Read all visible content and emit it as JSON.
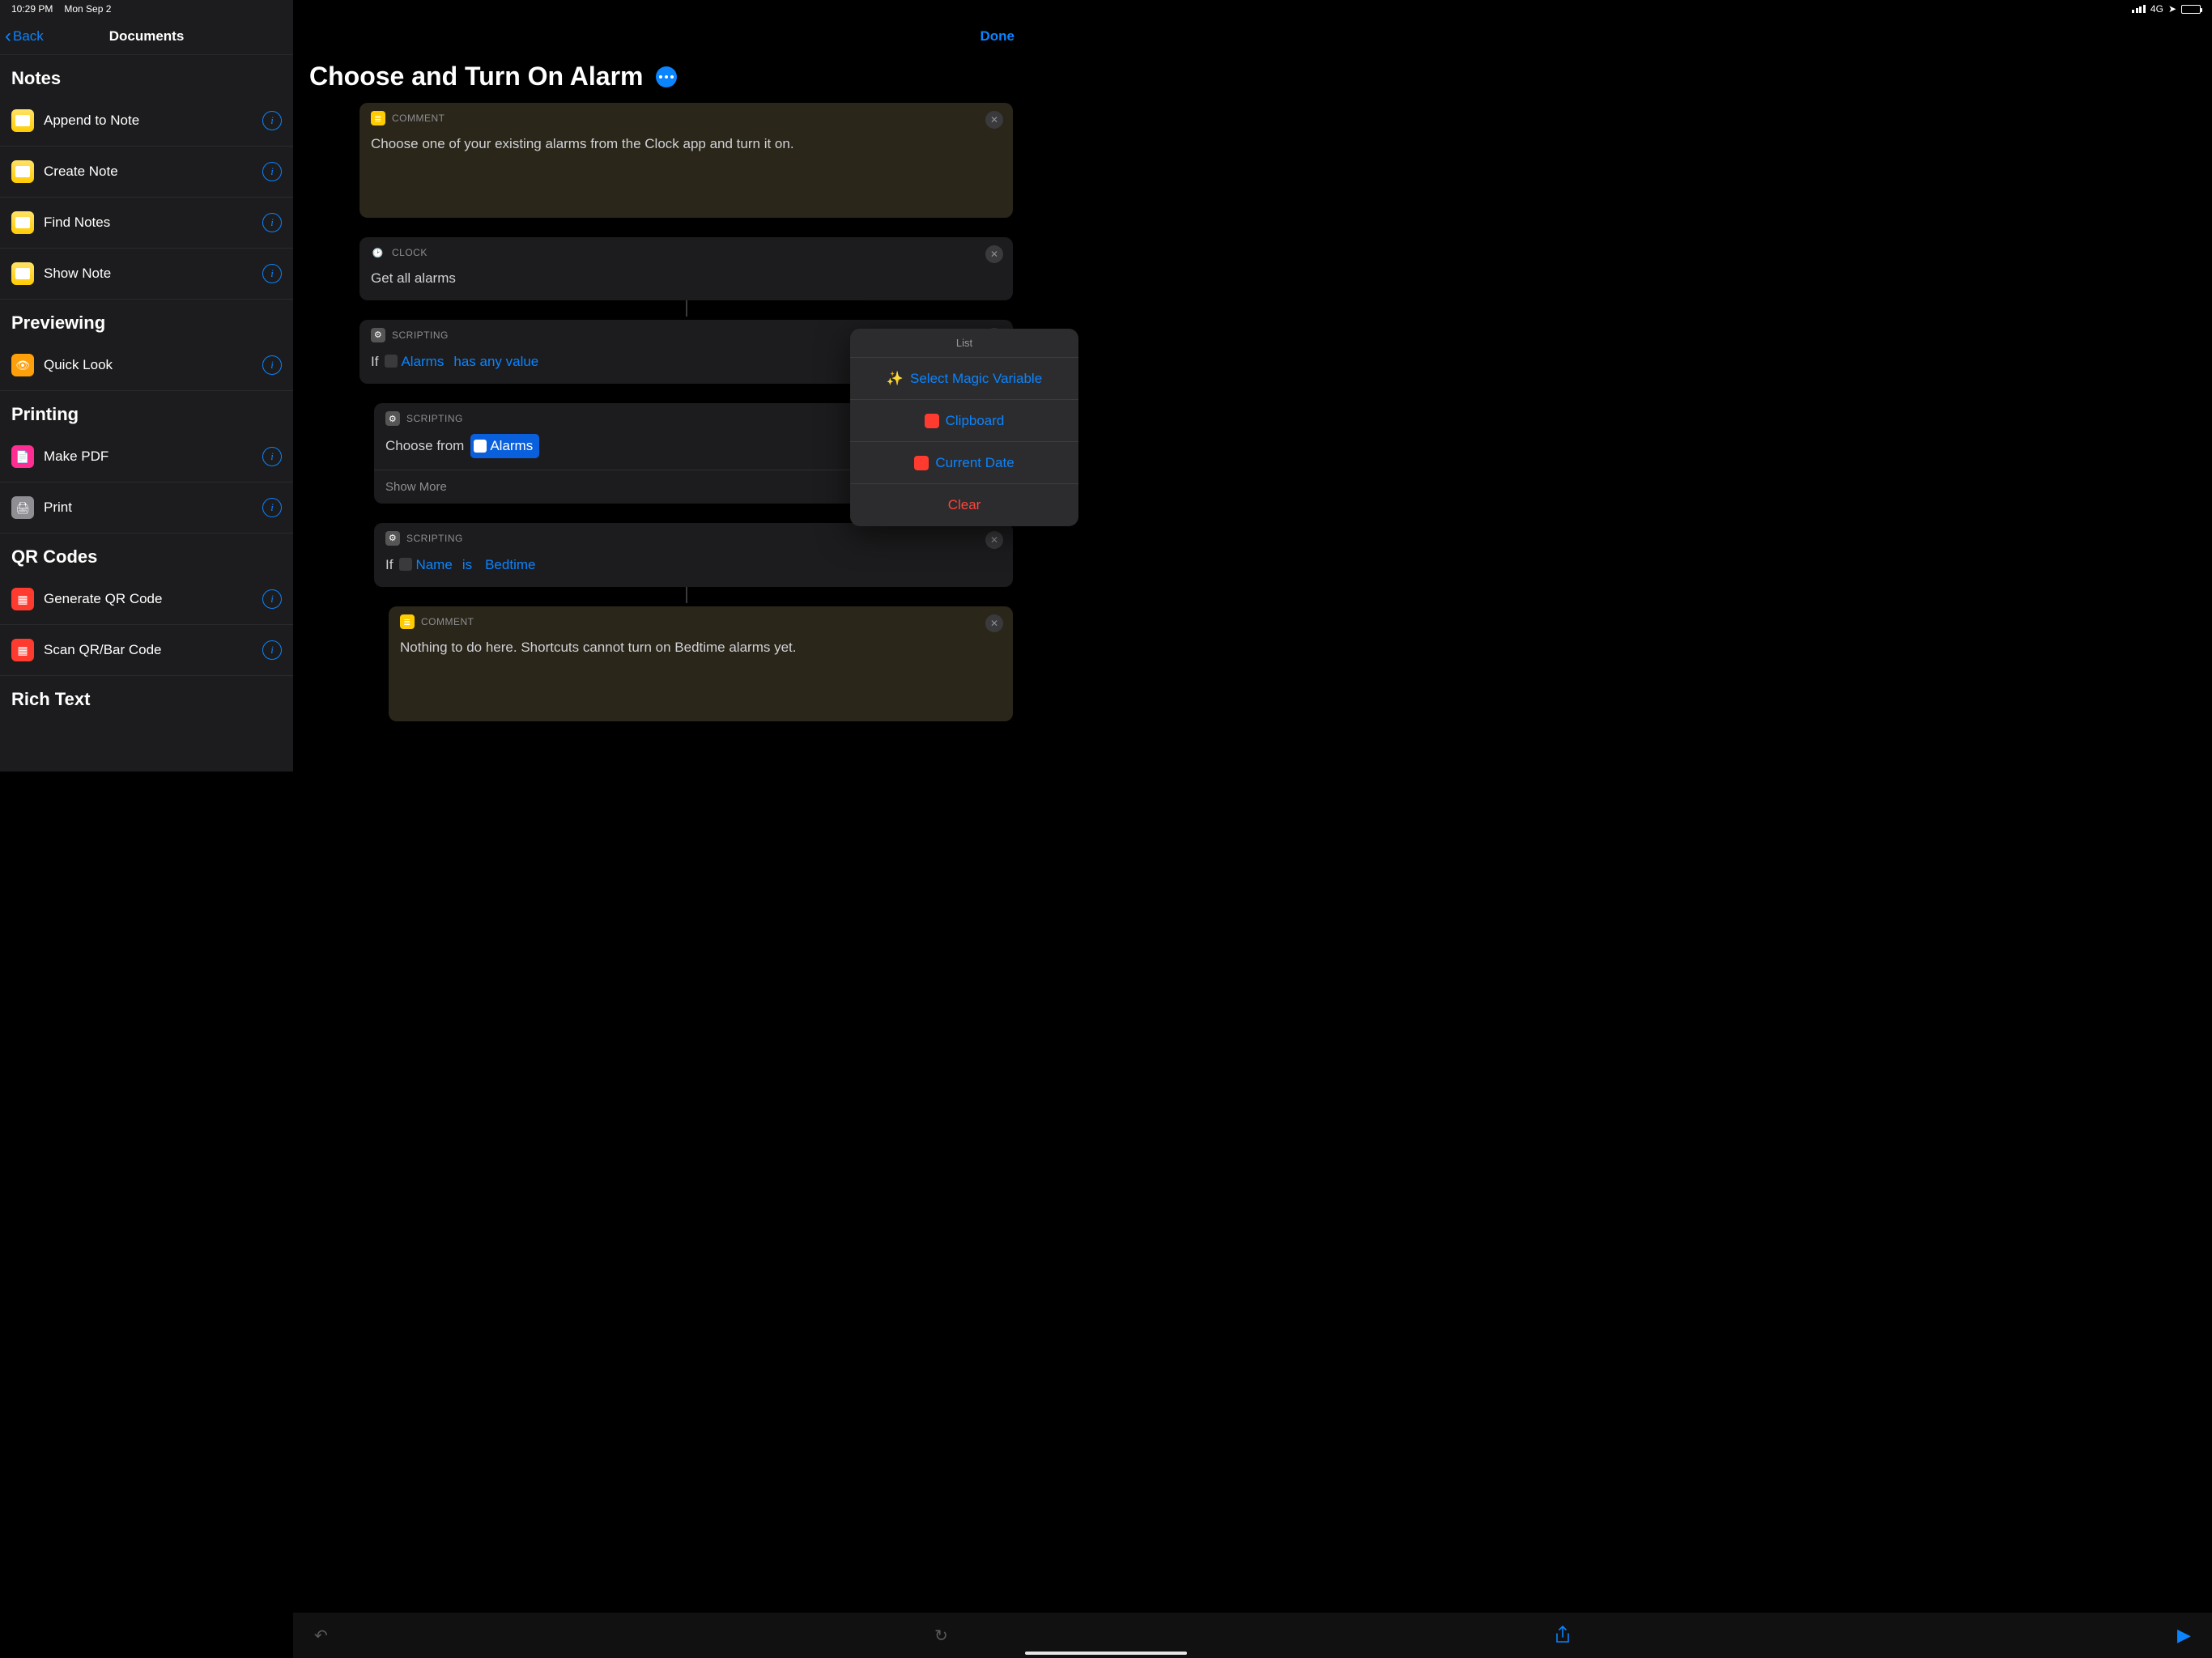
{
  "status": {
    "time": "10:29 PM",
    "date": "Mon Sep 2",
    "network": "4G"
  },
  "sidebar": {
    "back": "Back",
    "title": "Documents",
    "sections": [
      {
        "header": "Notes",
        "items": [
          {
            "label": "Append to Note",
            "icon": "notes"
          },
          {
            "label": "Create Note",
            "icon": "notes"
          },
          {
            "label": "Find Notes",
            "icon": "notes"
          },
          {
            "label": "Show Note",
            "icon": "notes"
          }
        ]
      },
      {
        "header": "Previewing",
        "items": [
          {
            "label": "Quick Look",
            "icon": "eye"
          }
        ]
      },
      {
        "header": "Printing",
        "items": [
          {
            "label": "Make PDF",
            "icon": "pdf"
          },
          {
            "label": "Print",
            "icon": "print"
          }
        ]
      },
      {
        "header": "QR Codes",
        "items": [
          {
            "label": "Generate QR Code",
            "icon": "qr"
          },
          {
            "label": "Scan QR/Bar Code",
            "icon": "qr"
          }
        ]
      },
      {
        "header": "Rich Text",
        "items": []
      }
    ]
  },
  "main": {
    "done": "Done",
    "title": "Choose and Turn On Alarm",
    "actions": [
      {
        "type": "comment",
        "app": "COMMENT",
        "body": "Choose one of your existing alarms from the Clock app and turn it on."
      },
      {
        "type": "clock",
        "app": "CLOCK",
        "body": "Get all alarms"
      },
      {
        "type": "if",
        "app": "SCRIPTING",
        "prefix": "If",
        "var": "Alarms",
        "cond": "has any value"
      },
      {
        "type": "choose",
        "app": "SCRIPTING",
        "prefix": "Choose from",
        "chip": "Alarms",
        "show_more": "Show More"
      },
      {
        "type": "if2",
        "app": "SCRIPTING",
        "prefix": "If",
        "var": "Name",
        "op": "is",
        "val": "Bedtime"
      },
      {
        "type": "comment2",
        "app": "COMMENT",
        "body": "Nothing to do here. Shortcuts cannot turn on Bedtime alarms yet."
      }
    ]
  },
  "popover": {
    "title": "List",
    "magic": "Select Magic Variable",
    "clipboard": "Clipboard",
    "date": "Current Date",
    "clear": "Clear"
  }
}
